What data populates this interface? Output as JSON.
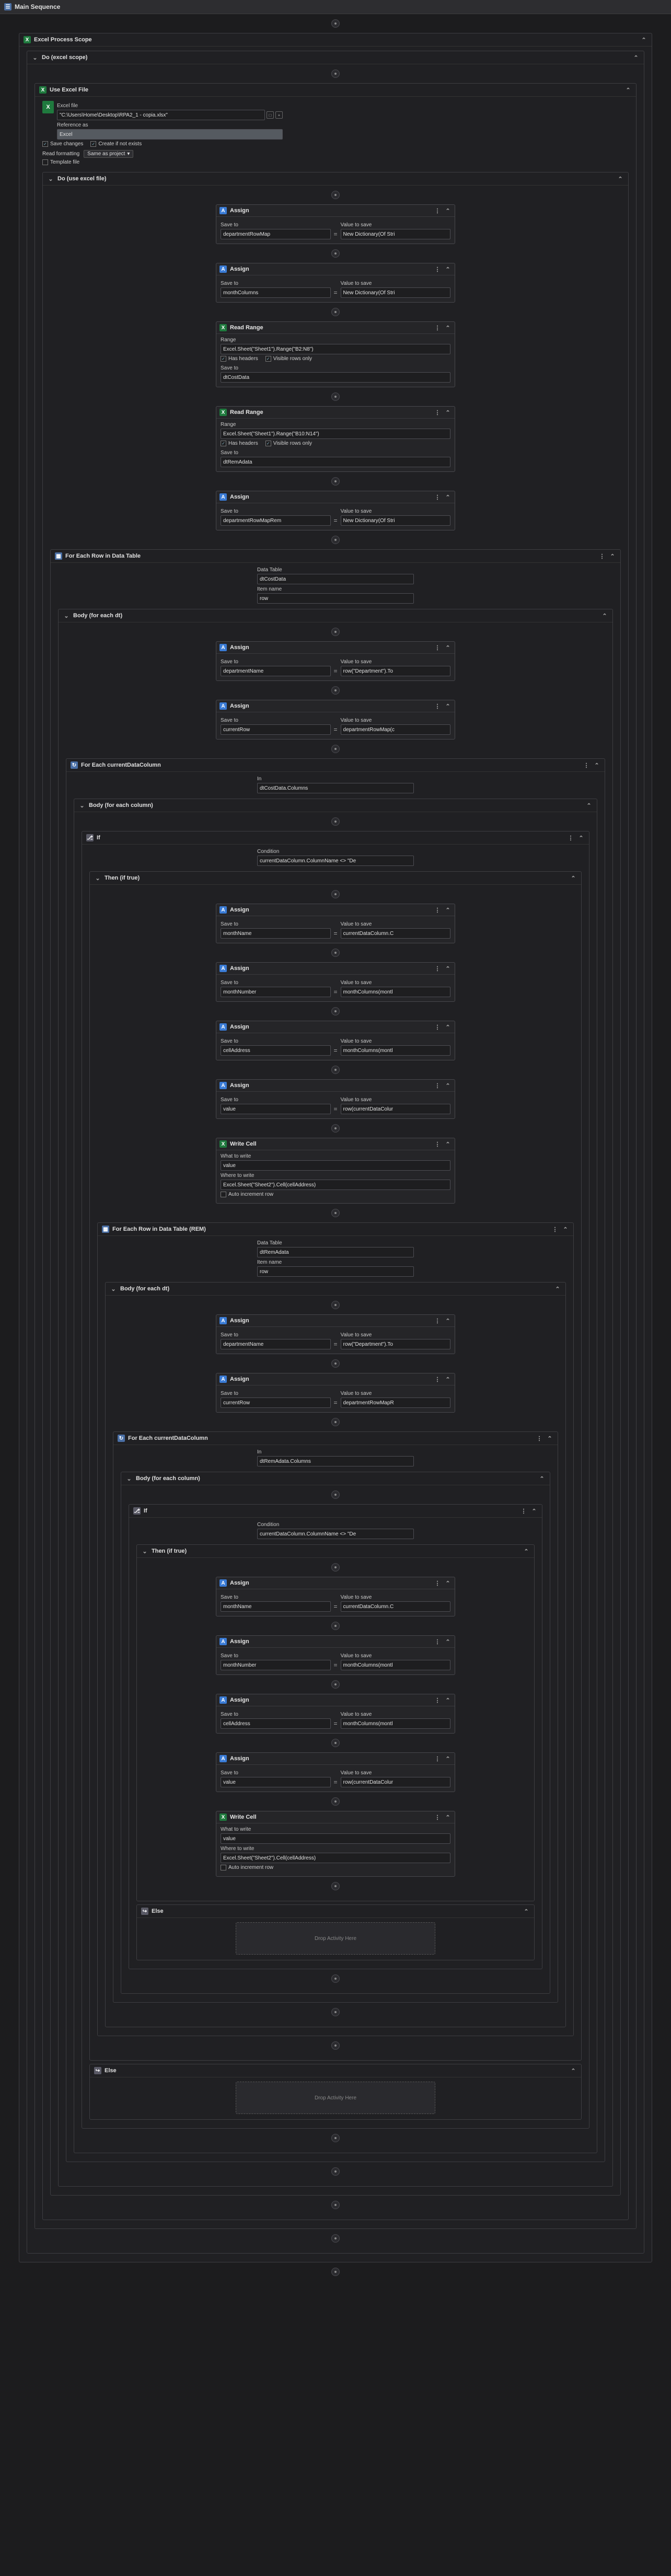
{
  "window": {
    "title": "Main Sequence"
  },
  "labels": {
    "save_to": "Save to",
    "value_to_save": "Value to save",
    "range": "Range",
    "has_headers": "Has headers",
    "visible_rows_only": "Visible rows only",
    "data_table": "Data Table",
    "item_name": "Item name",
    "in": "In",
    "condition": "Condition",
    "what_to_write": "What to write",
    "where_to_write": "Where to write",
    "auto_increment_row": "Auto increment row",
    "drop_activity": "Drop Activity Here",
    "excel_file": "Excel file",
    "reference_as": "Reference as",
    "save_changes": "Save changes",
    "create_if_not_exists": "Create if not exists",
    "read_formatting": "Read formatting",
    "template_file": "Template file"
  },
  "activities": {
    "excel_process_scope": "Excel Process Scope",
    "do_excel_scope": "Do (excel scope)",
    "use_excel_file": "Use Excel File",
    "do_use_excel_file": "Do (use excel file)",
    "assign": "Assign",
    "read_range": "Read Range",
    "for_each_row": "For Each Row in Data Table",
    "for_each_row_rem": "For Each Row in Data Table (REM)",
    "body_each_dt": "Body (for each dt)",
    "for_each_column": "For Each currentDataColumn",
    "body_each_column": "Body (for each column)",
    "if": "If",
    "then": "Then (if true)",
    "else": "Else",
    "write_cell": "Write Cell"
  },
  "use_excel": {
    "file_path": "\"C:\\Users\\Home\\Desktop\\RPA2_1 - copia.xlsx\"",
    "reference": "Excel",
    "read_formatting": "Same as project"
  },
  "assigns": {
    "a1": {
      "to": "departmentRowMap",
      "value": "New Dictionary(Of Stri"
    },
    "a2": {
      "to": "monthColumns",
      "value": "New Dictionary(Of Stri"
    },
    "a3": {
      "to": "departmentRowMapRem",
      "value": "New Dictionary(Of Stri"
    },
    "b1": {
      "to": "departmentName",
      "value": "row(\"Department\").To"
    },
    "b2": {
      "to": "currentRow",
      "value": "departmentRowMap(c"
    },
    "c1": {
      "to": "monthName",
      "value": "currentDataColumn.C"
    },
    "c2": {
      "to": "monthNumber",
      "value": "monthColumns(montl"
    },
    "c3": {
      "to": "cellAddress",
      "value": "monthColumns(montl"
    },
    "c4": {
      "to": "value",
      "value": "row(currentDataColur"
    },
    "d1": {
      "to": "departmentName",
      "value": "row(\"Department\").To"
    },
    "d2": {
      "to": "currentRow",
      "value": "departmentRowMapR"
    },
    "e1": {
      "to": "monthName",
      "value": "currentDataColumn.C"
    },
    "e2": {
      "to": "monthNumber",
      "value": "monthColumns(montl"
    },
    "e3": {
      "to": "cellAddress",
      "value": "monthColumns(montl"
    },
    "e4": {
      "to": "value",
      "value": "row(currentDataColur"
    }
  },
  "read_ranges": {
    "r1": {
      "range": "Excel.Sheet(\"Sheet1\").Range(\"B2:N8\")",
      "save_to": "dtCostData"
    },
    "r2": {
      "range": "Excel.Sheet(\"Sheet1\").Range(\"B10:N14\")",
      "save_to": "dtRemAdata"
    }
  },
  "loops": {
    "f1": {
      "table": "dtCostData",
      "item": "row"
    },
    "c1": {
      "in": "dtCostData.Columns"
    },
    "f2": {
      "table": "dtRemAdata",
      "item": "row"
    },
    "c2": {
      "in": "dtRemAdata.Columns"
    }
  },
  "ifs": {
    "i1": {
      "condition": "currentDataColumn.ColumnName <> \"De"
    },
    "i2": {
      "condition": "currentDataColumn.ColumnName <> \"De"
    }
  },
  "writes": {
    "w1": {
      "what": "value",
      "where": "Excel.Sheet(\"Sheet2\").Cell(cellAddress)"
    },
    "w2": {
      "what": "value",
      "where": "Excel.Sheet(\"Sheet2\").Cell(cellAddress)"
    }
  },
  "colors": {
    "assign_icon": "#3a7bd5",
    "excel_icon": "#1f7a3e",
    "seq_icon": "#4a6fa5"
  }
}
